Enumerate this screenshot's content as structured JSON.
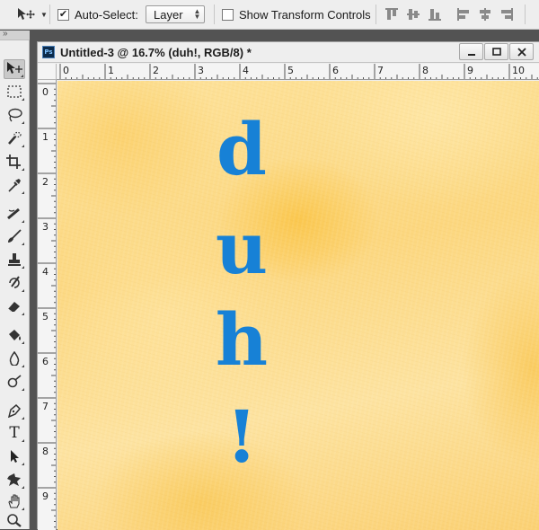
{
  "options_bar": {
    "auto_select_label": "Auto-Select:",
    "auto_select_checked": true,
    "auto_select_target": "Layer",
    "show_transform_label": "Show Transform Controls",
    "show_transform_checked": false
  },
  "tools": [
    {
      "name": "move-tool-icon",
      "active": true
    },
    {
      "name": "rectangular-marquee-tool-icon"
    },
    {
      "name": "lasso-tool-icon"
    },
    {
      "name": "quick-selection-tool-icon"
    },
    {
      "name": "crop-tool-icon"
    },
    {
      "name": "eyedropper-tool-icon"
    },
    {
      "name": "spot-healing-brush-tool-icon"
    },
    {
      "name": "brush-tool-icon"
    },
    {
      "name": "clone-stamp-tool-icon"
    },
    {
      "name": "history-brush-tool-icon"
    },
    {
      "name": "eraser-tool-icon"
    },
    {
      "name": "paint-bucket-tool-icon"
    },
    {
      "name": "blur-tool-icon"
    },
    {
      "name": "dodge-tool-icon"
    },
    {
      "name": "pen-tool-icon"
    },
    {
      "name": "type-tool-icon",
      "glyph": "T"
    },
    {
      "name": "path-selection-tool-icon"
    },
    {
      "name": "custom-shape-tool-icon"
    },
    {
      "name": "hand-tool-icon"
    },
    {
      "name": "zoom-tool-icon"
    }
  ],
  "document": {
    "badge": "Ps",
    "title": "Untitled-3 @ 16.7% (duh!, RGB/8) *"
  },
  "rulers": {
    "top": [
      "0",
      "1",
      "2",
      "3",
      "4",
      "5",
      "6",
      "7",
      "8",
      "9",
      "10"
    ],
    "left": [
      "0",
      "1",
      "2",
      "3",
      "4",
      "5",
      "6",
      "7",
      "8",
      "9"
    ]
  },
  "canvas": {
    "text_layer_chars": [
      "d",
      "u",
      "h",
      "!"
    ],
    "text_color": "#1781d6",
    "background_color": "#fcd77f"
  }
}
